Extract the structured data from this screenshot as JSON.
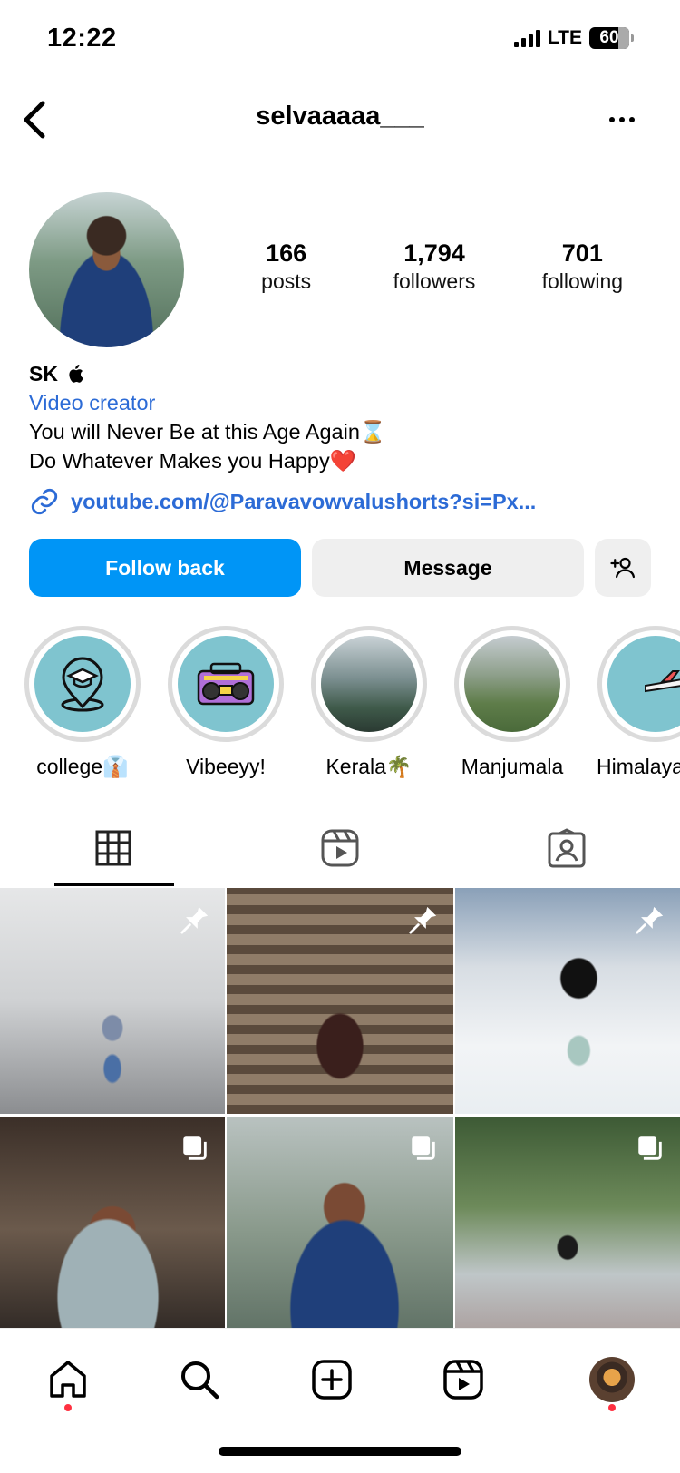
{
  "status_bar": {
    "time": "12:22",
    "network": "LTE",
    "battery": "60"
  },
  "header": {
    "username": "selvaaaaa___",
    "back_icon": "chevron-left-icon",
    "more_icon": "more-horizontal-icon"
  },
  "stats": {
    "posts": {
      "count": "166",
      "label": "posts"
    },
    "followers": {
      "count": "1,794",
      "label": "followers"
    },
    "following": {
      "count": "701",
      "label": "following"
    }
  },
  "bio": {
    "name": "SK",
    "category": "Video creator",
    "line1": "You will Never Be at this Age Again⌛",
    "line2": "Do Whatever Makes you Happy❤️",
    "link": "youtube.com/@Paravavowvalushorts?si=Px..."
  },
  "actions": {
    "follow_label": "Follow back",
    "message_label": "Message"
  },
  "highlights": [
    {
      "label": "college👔"
    },
    {
      "label": "Vibeeyy!"
    },
    {
      "label": "Kerala🌴"
    },
    {
      "label": "Manjumala"
    },
    {
      "label": "Himalayas"
    }
  ],
  "tabs": [
    {
      "name": "posts-grid",
      "icon": "grid-icon",
      "active": true
    },
    {
      "name": "reels",
      "icon": "reels-icon",
      "active": false
    },
    {
      "name": "tagged",
      "icon": "tagged-icon",
      "active": false
    }
  ],
  "posts": [
    {
      "badge": "pin-icon"
    },
    {
      "badge": "pin-icon"
    },
    {
      "badge": "pin-icon"
    },
    {
      "badge": "carousel-icon"
    },
    {
      "badge": "carousel-icon"
    },
    {
      "badge": "carousel-icon"
    }
  ],
  "bottom_nav": [
    "home-icon",
    "search-icon",
    "create-icon",
    "reels-icon",
    "profile-avatar"
  ],
  "colors": {
    "primary_blue": "#0095f6",
    "link_blue": "#2c6bd6",
    "notification_red": "#ff3040"
  }
}
